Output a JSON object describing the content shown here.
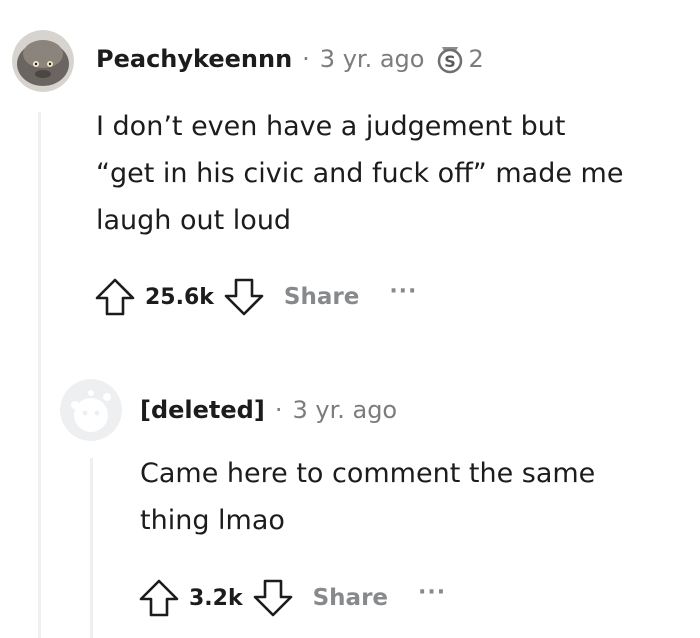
{
  "comments": [
    {
      "username": "Peachykeennn",
      "separator": "·",
      "time": "3 yr. ago",
      "award_icon": "silver-award-icon",
      "award_count": "2",
      "avatar_icon": "snoo-avatar-icon",
      "body_lines": [
        "I don’t even have a judgement but",
        "“get in his civic and fuck off” made me",
        "laugh out loud"
      ],
      "votes": "25.6k",
      "share_label": "Share",
      "more_label": "···"
    },
    {
      "username": "[deleted]",
      "separator": "·",
      "time": "3 yr. ago",
      "avatar_icon": "deleted-user-avatar-icon",
      "body_lines": [
        "Came here to comment the same",
        "thing lmao"
      ],
      "votes": "3.2k",
      "share_label": "Share",
      "more_label": "···"
    }
  ],
  "colors": {
    "text": "#1c1c1c",
    "meta": "#7c7c7c",
    "action": "#878a8c",
    "thread_line": "#edeff1"
  }
}
